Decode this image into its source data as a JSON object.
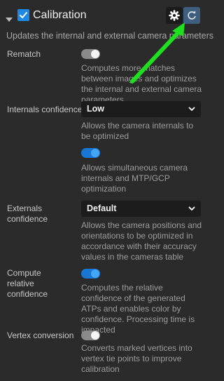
{
  "header": {
    "title": "Calibration",
    "subtitle": "Updates the internal and external camera parameters",
    "checked": true,
    "gear_icon": "gear-icon",
    "refresh_icon": "refresh-icon"
  },
  "settings": {
    "rematch": {
      "label": "Rematch",
      "enabled": false,
      "description": "Computes more matches between images and optimizes the internal and external camera parameters"
    },
    "internals_confidence": {
      "label": "Internals confidence",
      "value": "Low",
      "description": "Allows the camera internals to be optimized"
    },
    "simultaneous": {
      "enabled": true,
      "description": "Allows simultaneous camera internals and MTP/GCP optimization"
    },
    "externals_confidence": {
      "label": "Externals confidence",
      "value": "Default",
      "description": "Allows the camera positions and orientations to be optimized in accordance with their accuracy values in the cameras table"
    },
    "compute_relative_confidence": {
      "label": "Compute relative confidence",
      "enabled": true,
      "description": "Computes the relative confidence of the generated ATPs and enables color by confidence. Processing time is impacted"
    },
    "vertex_conversion": {
      "label": "Vertex conversion",
      "enabled": false,
      "description": "Converts marked vertices into vertex tie points to improve calibration"
    }
  },
  "colors": {
    "accent": "#1e88e5",
    "annotation_arrow": "#1fe01f",
    "background": "#2b2b2b"
  }
}
